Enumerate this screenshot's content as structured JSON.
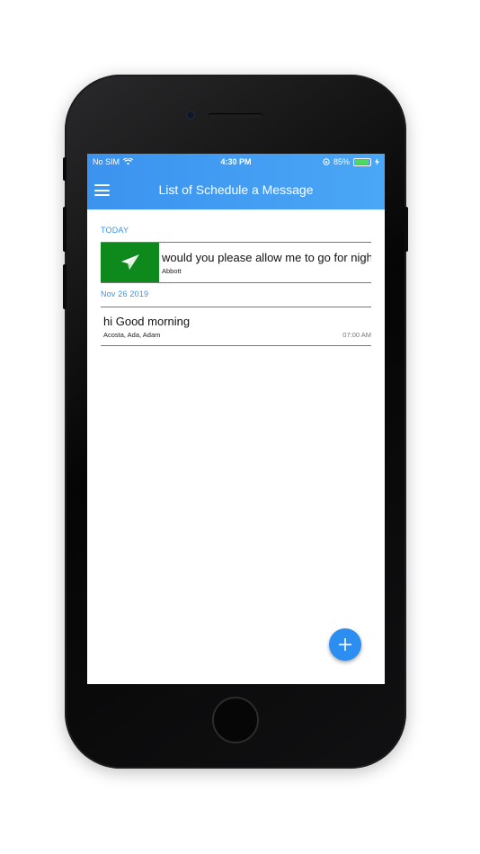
{
  "status_bar": {
    "carrier": "No SIM",
    "time": "4:30 PM",
    "battery": "85%",
    "battery_level": 0.85
  },
  "nav": {
    "title": "List of Schedule a Message",
    "menu_icon": "hamburger-menu-icon"
  },
  "sections": [
    {
      "label": "TODAY",
      "items": [
        {
          "message": "would you please allow me to go for night shift",
          "recipients": "Abbott",
          "icon": "paper-plane-icon",
          "badge_color": "#0e8a1c"
        }
      ]
    },
    {
      "label": "Nov 26 2019",
      "items": [
        {
          "message": "hi Good morning",
          "recipients": "Acosta, Ada, Adam",
          "time": "07:00 AM"
        }
      ]
    }
  ],
  "fab": {
    "icon": "plus-icon",
    "color": "#2b8ef0"
  },
  "accent_color": "#3b93ee"
}
